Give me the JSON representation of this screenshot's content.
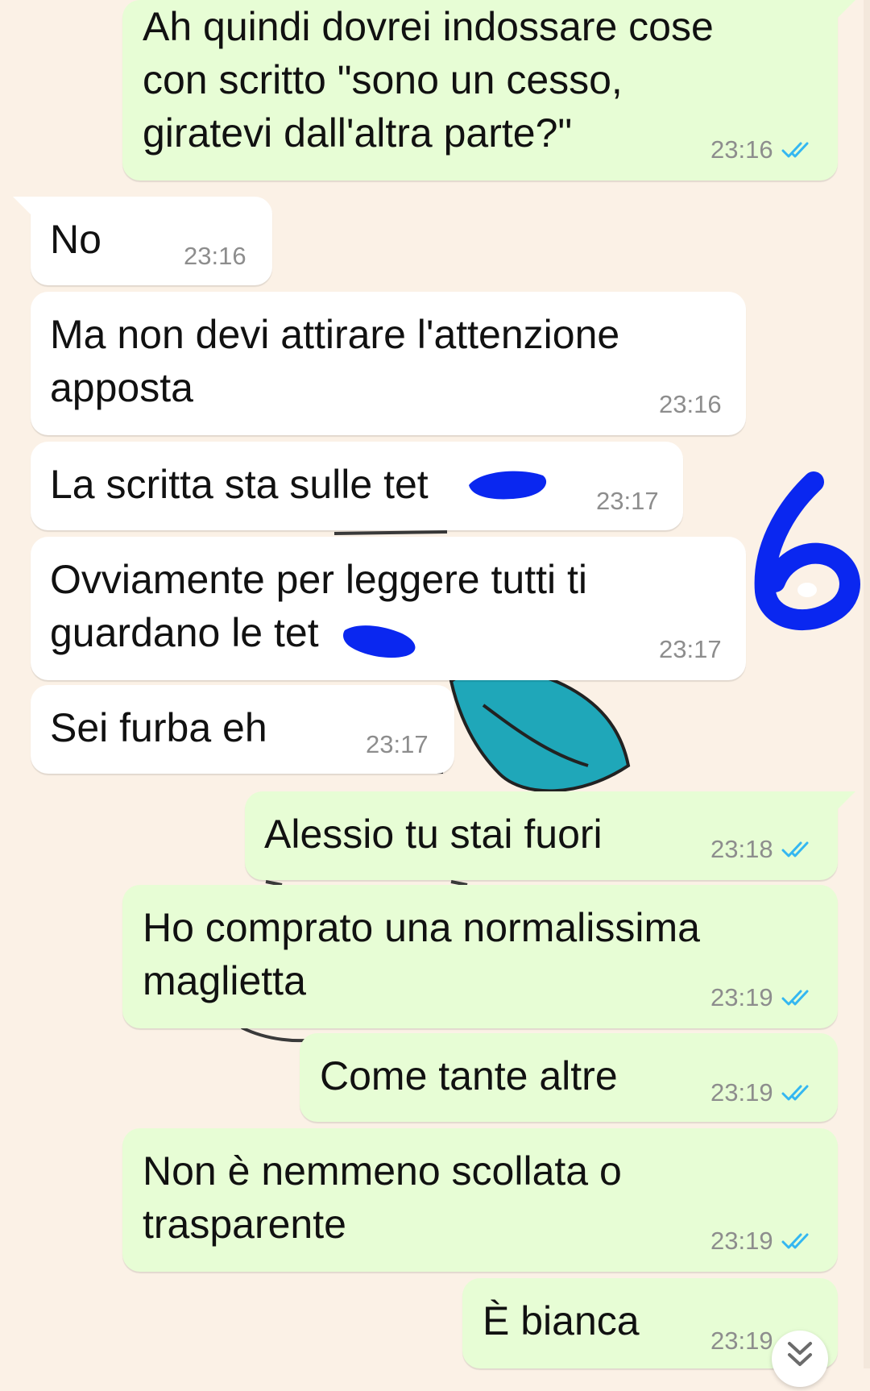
{
  "colors": {
    "background": "#fbf1e6",
    "sent_bubble": "#e7fdd5",
    "received_bubble": "#ffffff",
    "read_ticks": "#34b7f1",
    "scribble": "#0a27f0"
  },
  "messages": [
    {
      "direction": "sent",
      "text": "Ah quindi dovrei indossare cose\ncon scritto \"sono un cesso,\ngiratevi dall'altra parte?\"",
      "time": "23:16",
      "status": "read"
    },
    {
      "direction": "received",
      "text": "No",
      "time": "23:16"
    },
    {
      "direction": "received",
      "text": "Ma non devi attirare l'attenzione\napposta",
      "time": "23:16"
    },
    {
      "direction": "received",
      "text": "La scritta sta sulle tet",
      "time": "23:17"
    },
    {
      "direction": "received",
      "text": "Ovviamente per leggere tutti ti\nguardano le tet",
      "time": "23:17"
    },
    {
      "direction": "received",
      "text": "Sei furba eh",
      "time": "23:17"
    },
    {
      "direction": "sent",
      "text": "Alessio tu stai fuori",
      "time": "23:18",
      "status": "read"
    },
    {
      "direction": "sent",
      "text": "Ho comprato una normalissima\nmaglietta",
      "time": "23:19",
      "status": "read"
    },
    {
      "direction": "sent",
      "text": "Come tante altre",
      "time": "23:19",
      "status": "read"
    },
    {
      "direction": "sent",
      "text": "Non è nemmeno scollata o\ntrasparente",
      "time": "23:19",
      "status": "read"
    },
    {
      "direction": "sent",
      "text": "È bianca",
      "time": "23:19",
      "status": "read"
    }
  ],
  "annotation": {
    "text": "6"
  },
  "scroll_button": {
    "icon": "double-chevron-down-icon"
  }
}
